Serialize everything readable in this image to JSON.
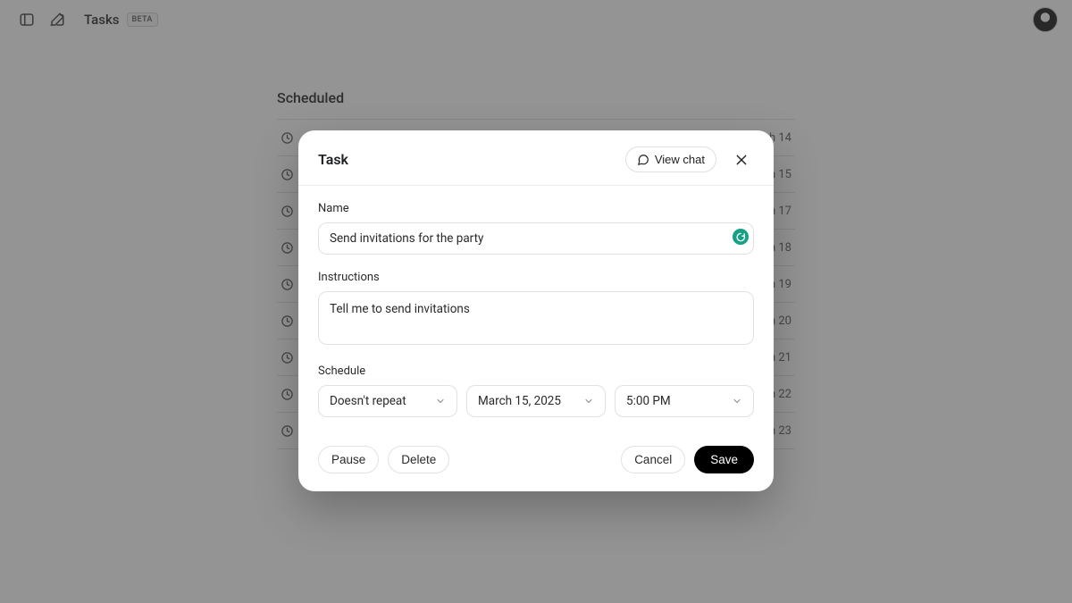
{
  "header": {
    "title": "Tasks",
    "badge": "BETA"
  },
  "section_title": "Scheduled",
  "tasks": [
    {
      "name": "",
      "date": "March 14"
    },
    {
      "name": "",
      "date": "March 15"
    },
    {
      "name": "",
      "date": "March 17"
    },
    {
      "name": "",
      "date": "March 18"
    },
    {
      "name": "",
      "date": "March 19"
    },
    {
      "name": "",
      "date": "March 20"
    },
    {
      "name": "",
      "date": "March 21"
    },
    {
      "name": "",
      "date": "March 22"
    },
    {
      "name": "",
      "date": "March 23"
    }
  ],
  "modal": {
    "title": "Task",
    "view_chat_label": "View chat",
    "name_label": "Name",
    "name_value": "Send invitations for the party",
    "instructions_label": "Instructions",
    "instructions_value": "Tell me to send invitations",
    "schedule_label": "Schedule",
    "repeat_value": "Doesn't repeat",
    "date_value": "March 15, 2025",
    "time_value": "5:00 PM",
    "pause_label": "Pause",
    "delete_label": "Delete",
    "cancel_label": "Cancel",
    "save_label": "Save"
  }
}
